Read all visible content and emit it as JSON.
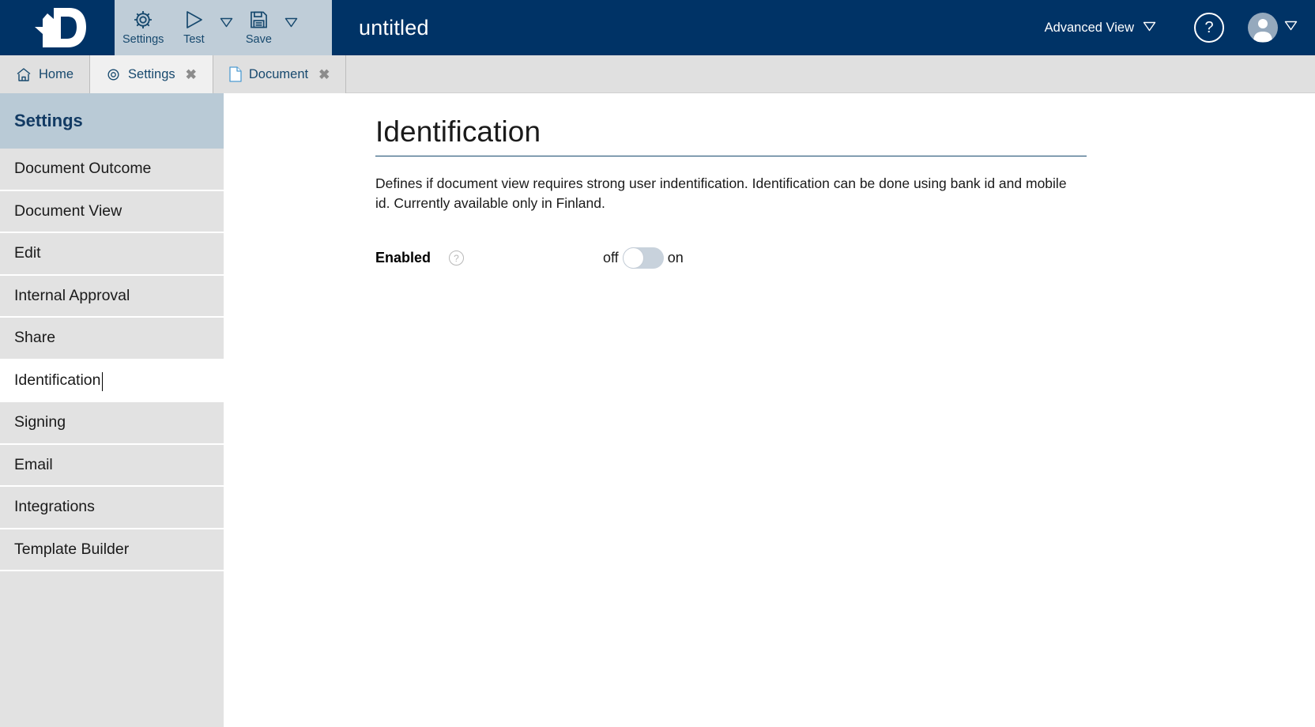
{
  "app": {
    "logo_name": "d-logo",
    "brand_color": "#003366",
    "toolbar_color": "#bfcdd8",
    "sidebar_header_color": "#b9cad6"
  },
  "header": {
    "document_title": "untitled",
    "toolbar": [
      {
        "label": "Settings",
        "icon": "gear-icon",
        "has_caret": false
      },
      {
        "label": "Test",
        "icon": "play-icon",
        "has_caret": true
      },
      {
        "label": "Save",
        "icon": "floppy-disk-icon",
        "has_caret": true
      }
    ],
    "advanced_view_label": "Advanced View",
    "help_icon_glyph": "?",
    "avatar_icon": "user-avatar-icon"
  },
  "tabs": [
    {
      "label": "Home",
      "icon": "home-icon",
      "closable": false,
      "active": false
    },
    {
      "label": "Settings",
      "icon": "gear-icon",
      "closable": true,
      "active": true,
      "close_glyph": "✖"
    },
    {
      "label": "Document",
      "icon": "document-icon",
      "closable": true,
      "active": false,
      "close_glyph": "✖"
    }
  ],
  "sidebar": {
    "title": "Settings",
    "items": [
      {
        "label": "Document Outcome",
        "state": "normal"
      },
      {
        "label": "Document View",
        "state": "normal"
      },
      {
        "label": "Edit",
        "state": "normal"
      },
      {
        "label": "Internal Approval",
        "state": "normal"
      },
      {
        "label": "Share",
        "state": "normal"
      },
      {
        "label": "Identification",
        "state": "editing"
      },
      {
        "label": "Signing",
        "state": "normal"
      },
      {
        "label": "Email",
        "state": "normal"
      },
      {
        "label": "Integrations",
        "state": "normal"
      },
      {
        "label": "Template Builder",
        "state": "normal"
      }
    ]
  },
  "main": {
    "title": "Identification",
    "description": "Defines if document view requires strong user indentification. Identification can be done using bank id and mobile id. Currently available only in Finland.",
    "field": {
      "label": "Enabled",
      "help_glyph": "?",
      "toggle_off_label": "off",
      "toggle_on_label": "on",
      "toggle_value": "off"
    }
  }
}
